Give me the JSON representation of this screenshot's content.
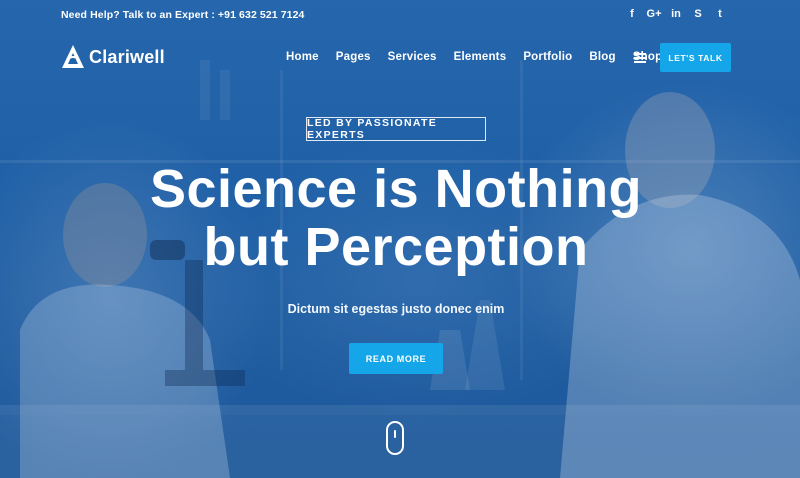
{
  "topbar": {
    "help_text": "Need Help? Talk to an Expert : +91 632 521 7124",
    "socials": [
      {
        "icon": "facebook-icon",
        "glyph": "f"
      },
      {
        "icon": "google-plus-icon",
        "glyph": "G+"
      },
      {
        "icon": "linkedin-icon",
        "glyph": "in"
      },
      {
        "icon": "skype-icon",
        "glyph": "S"
      },
      {
        "icon": "twitter-icon",
        "glyph": "t"
      }
    ]
  },
  "header": {
    "logo_text": "Clariwell",
    "nav": [
      "Home",
      "Pages",
      "Services",
      "Elements",
      "Portfolio",
      "Blog",
      "Shop"
    ],
    "cta_label": "LET'S TALK"
  },
  "hero": {
    "tagline": "LED BY PASSIONATE EXPERTS",
    "title_line1": "Science is Nothing",
    "title_line2": "but Perception",
    "subtitle": "Dictum sit egestas justo donec enim",
    "button_label": "READ MORE"
  },
  "colors": {
    "accent": "#14a6e8",
    "hero_blue": "#2163a8"
  }
}
